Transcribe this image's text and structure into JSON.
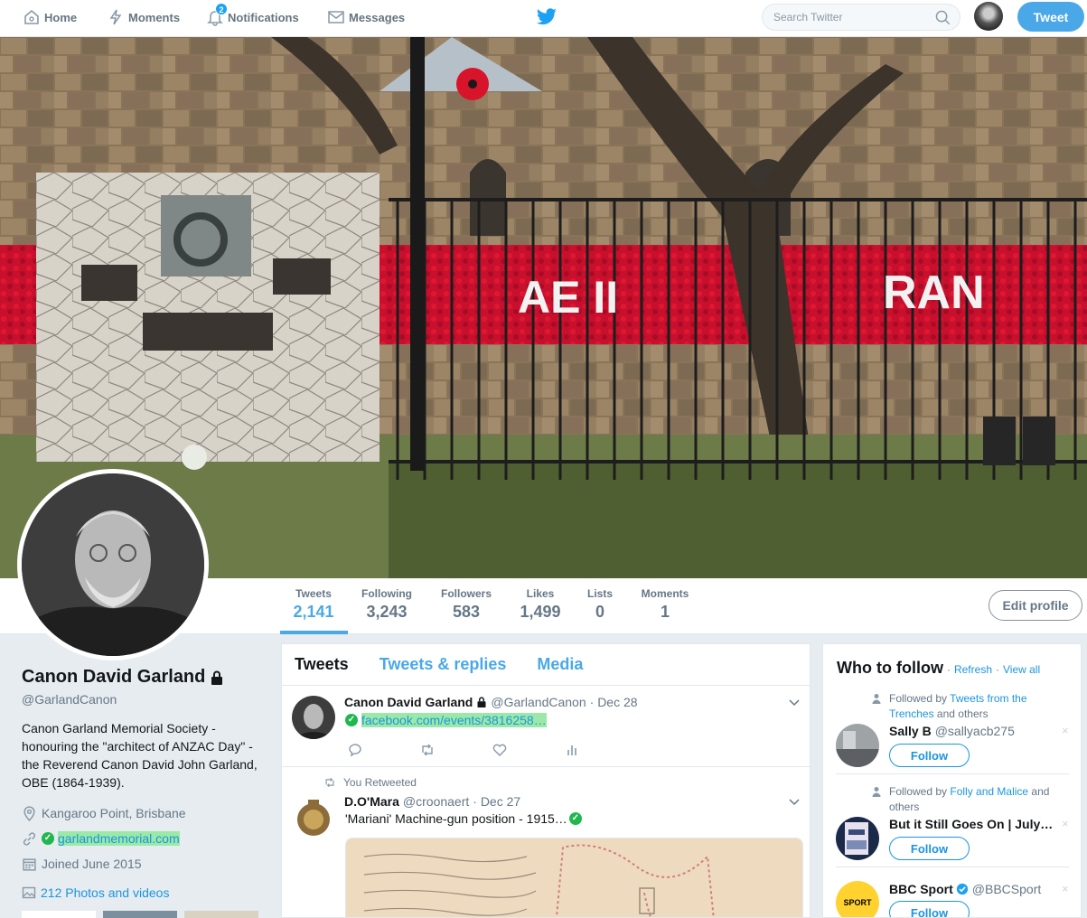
{
  "nav": {
    "home": "Home",
    "moments": "Moments",
    "notifications": "Notifications",
    "notification_count": "2",
    "messages": "Messages",
    "search_placeholder": "Search Twitter",
    "tweet_button": "Tweet"
  },
  "banner": {
    "sign_left": "AE II",
    "sign_right": "RAN"
  },
  "stats": {
    "tweets_label": "Tweets",
    "tweets_value": "2,141",
    "following_label": "Following",
    "following_value": "3,243",
    "followers_label": "Followers",
    "followers_value": "583",
    "likes_label": "Likes",
    "likes_value": "1,499",
    "lists_label": "Lists",
    "lists_value": "0",
    "moments_label": "Moments",
    "moments_value": "1",
    "edit_profile": "Edit profile"
  },
  "profile": {
    "name": "Canon David Garland",
    "handle": "@GarlandCanon",
    "bio": "Canon Garland Memorial Society - honouring the \"architect of ANZAC Day\" - the Reverend Canon David John Garland, OBE (1864-1939).",
    "location": "Kangaroo Point, Brisbane",
    "website": "garlandmemorial.com",
    "joined": "Joined June 2015",
    "photos": "212 Photos and videos"
  },
  "timeline": {
    "tabs": [
      "Tweets",
      "Tweets & replies",
      "Media"
    ],
    "tweet1": {
      "name": "Canon David Garland",
      "handle": "@GarlandCanon",
      "date": "· Dec 28",
      "link": "facebook.com/events/3816258…"
    },
    "tweet2": {
      "retweet_note": "You Retweeted",
      "name": "D.O'Mara",
      "handle": "@croonaert",
      "date": "· Dec 27",
      "text": "'Mariani' Machine-gun position - 1915…"
    }
  },
  "who_to_follow": {
    "title": "Who to follow",
    "refresh": "Refresh",
    "view_all": "View all",
    "dot": "·",
    "follow_label": "Follow",
    "dismiss": "×",
    "items": [
      {
        "followed_by_prefix": "Followed by",
        "followed_by_link": "Tweets from the Trenches",
        "followed_by_suffix": "and others",
        "name": "Sally B",
        "handle": "@sallyacb275"
      },
      {
        "followed_by_prefix": "Followed by",
        "followed_by_link": "Folly and Malice",
        "followed_by_suffix": "and others",
        "name": "But it Still Goes On | July…",
        "handle": ""
      },
      {
        "name": "BBC Sport",
        "handle": "@BBCSport",
        "logo_text": "SPORT"
      }
    ]
  },
  "colors": {
    "accent": "#1da1f2",
    "link": "#1b95e0",
    "verified_green": "#1fb84e"
  }
}
